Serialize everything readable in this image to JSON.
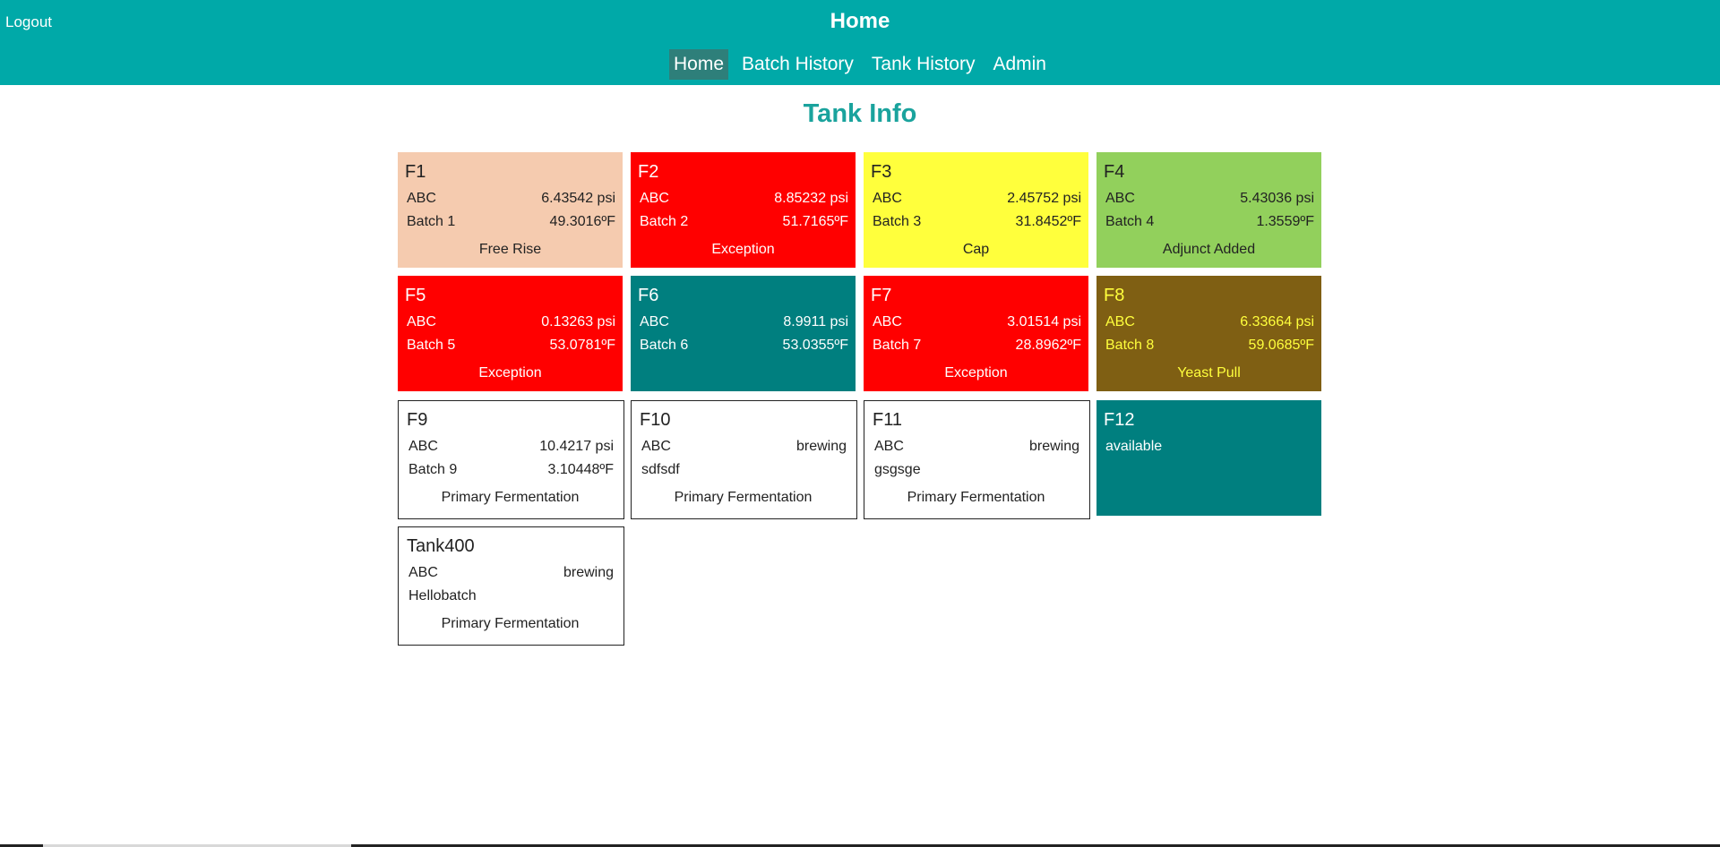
{
  "header": {
    "logout_label": "Logout",
    "title": "Home",
    "background": "#00a9a8"
  },
  "nav": {
    "items": [
      {
        "label": "Home",
        "active": true
      },
      {
        "label": "Batch History",
        "active": false
      },
      {
        "label": "Tank History",
        "active": false
      },
      {
        "label": "Admin",
        "active": false
      }
    ]
  },
  "section_title": "Tank Info",
  "tanks": [
    {
      "name": "F1",
      "beer": "ABC",
      "reading": "6.43542 psi",
      "batch": "Batch 1",
      "temp": "49.3016ºF",
      "status": "Free Rise",
      "bg": "#f5cbaf",
      "fg": "#222222"
    },
    {
      "name": "F2",
      "beer": "ABC",
      "reading": "8.85232 psi",
      "batch": "Batch 2",
      "temp": "51.7165ºF",
      "status": "Exception",
      "bg": "#ff0000",
      "fg": "#ffffff"
    },
    {
      "name": "F3",
      "beer": "ABC",
      "reading": "2.45752 psi",
      "batch": "Batch 3",
      "temp": "31.8452ºF",
      "status": "Cap",
      "bg": "#ffff3c",
      "fg": "#222222"
    },
    {
      "name": "F4",
      "beer": "ABC",
      "reading": "5.43036 psi",
      "batch": "Batch 4",
      "temp": "1.3559ºF",
      "status": "Adjunct Added",
      "bg": "#92d05c",
      "fg": "#222222"
    },
    {
      "name": "F5",
      "beer": "ABC",
      "reading": "0.13263 psi",
      "batch": "Batch 5",
      "temp": "53.0781ºF",
      "status": "Exception",
      "bg": "#ff0000",
      "fg": "#ffffff"
    },
    {
      "name": "F6",
      "beer": "ABC",
      "reading": "8.9911 psi",
      "batch": "Batch 6",
      "temp": "53.0355ºF",
      "status": "",
      "bg": "#007f7f",
      "fg": "#ffffff"
    },
    {
      "name": "F7",
      "beer": "ABC",
      "reading": "3.01514 psi",
      "batch": "Batch 7",
      "temp": "28.8962ºF",
      "status": "Exception",
      "bg": "#ff0000",
      "fg": "#ffffff"
    },
    {
      "name": "F8",
      "beer": "ABC",
      "reading": "6.33664 psi",
      "batch": "Batch 8",
      "temp": "59.0685ºF",
      "status": "Yeast Pull",
      "bg": "#7f5f13",
      "fg": "#ffff3c"
    },
    {
      "name": "F9",
      "beer": "ABC",
      "reading": "10.4217 psi",
      "batch": "Batch 9",
      "temp": "3.10448ºF",
      "status": "Primary Fermentation",
      "bg": "#ffffff",
      "fg": "#222222",
      "bordered": true
    },
    {
      "name": "F10",
      "beer": "ABC",
      "reading": "brewing",
      "batch": "sdfsdf",
      "temp": "",
      "status": "Primary Fermentation",
      "bg": "#ffffff",
      "fg": "#222222",
      "bordered": true
    },
    {
      "name": "F11",
      "beer": "ABC",
      "reading": "brewing",
      "batch": "gsgsge",
      "temp": "",
      "status": "Primary Fermentation",
      "bg": "#ffffff",
      "fg": "#222222",
      "bordered": true
    },
    {
      "name": "F12",
      "beer": "available",
      "reading": "",
      "batch": "",
      "temp": "",
      "status": "",
      "bg": "#007f7f",
      "fg": "#ffffff"
    },
    {
      "name": "Tank400",
      "beer": "ABC",
      "reading": "brewing",
      "batch": "Hellobatch",
      "temp": "",
      "status": "Primary Fermentation",
      "bg": "#ffffff",
      "fg": "#222222",
      "bordered": true
    }
  ]
}
